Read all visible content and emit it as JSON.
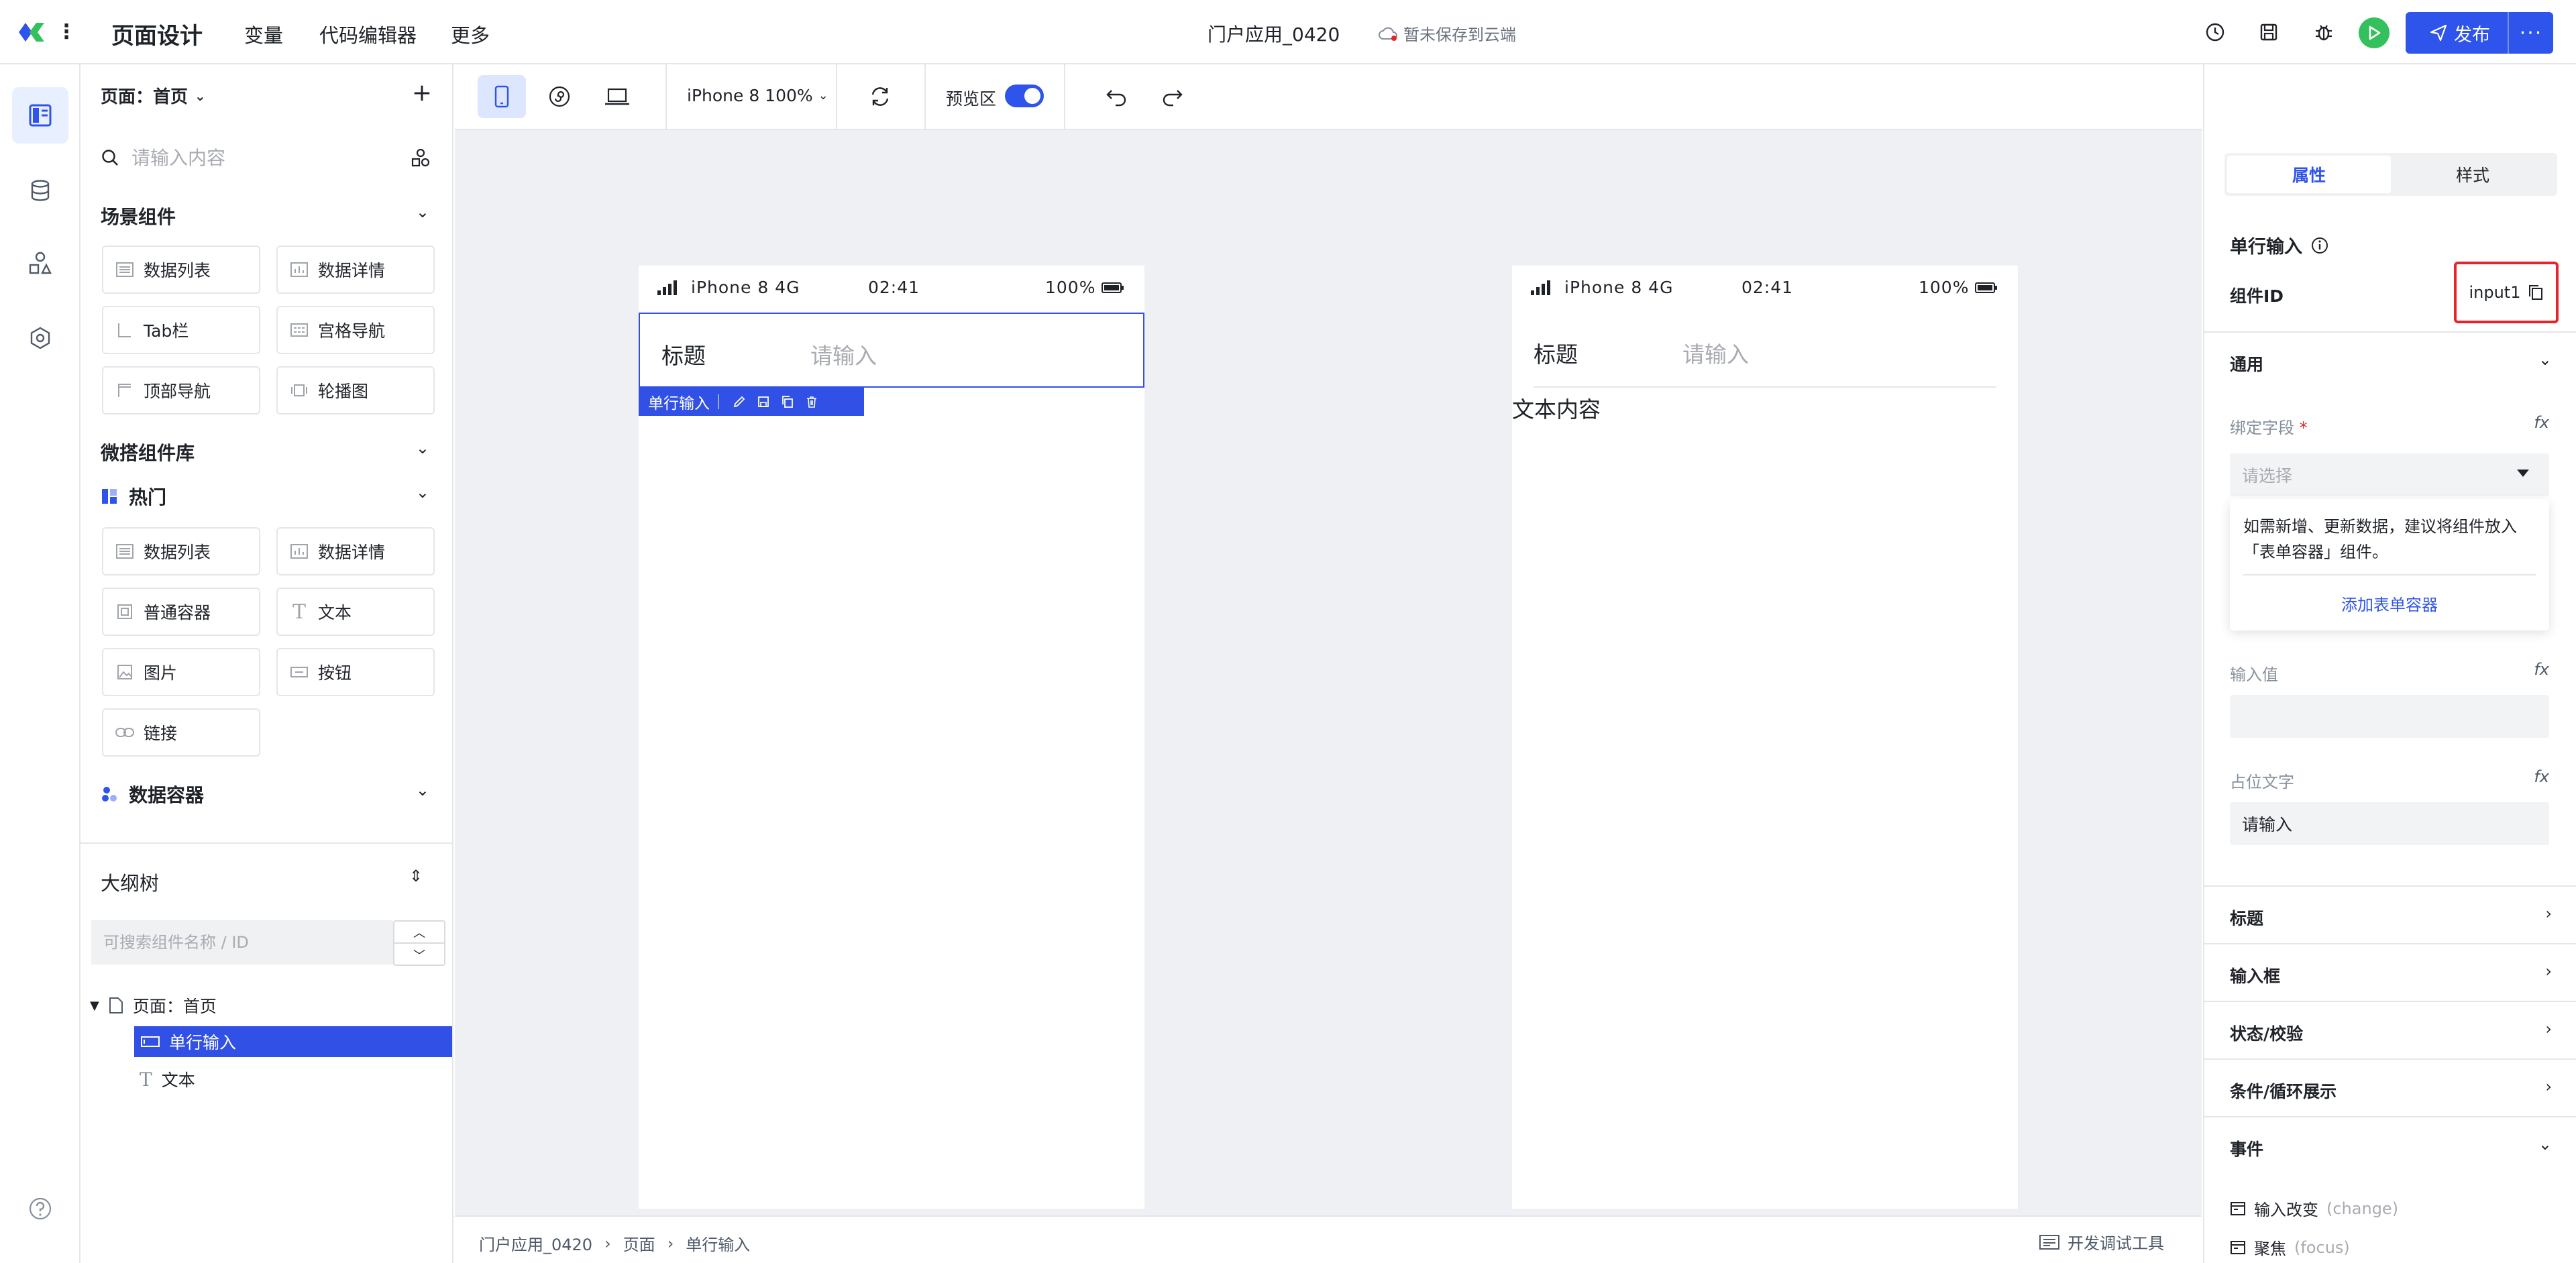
{
  "topbar": {
    "app_title": "页面设计",
    "nav": [
      "变量",
      "代码编辑器",
      "更多"
    ],
    "project_name": "门户应用_0420",
    "save_status": "暂未保存到云端",
    "publish_label": "发布",
    "more_label": "···"
  },
  "panel": {
    "page_selector": "页面：首页",
    "add_label": "+",
    "search_placeholder": "请输入内容",
    "groups": {
      "scene": {
        "title": "场景组件",
        "items": [
          "数据列表",
          "数据详情",
          "Tab栏",
          "宫格导航",
          "顶部导航",
          "轮播图"
        ]
      },
      "micro": {
        "title": "微搭组件库"
      },
      "hot": {
        "title": "热门",
        "items": [
          "数据列表",
          "数据详情",
          "普通容器",
          "文本",
          "图片",
          "按钮",
          "链接"
        ]
      },
      "data_container": {
        "title": "数据容器"
      }
    }
  },
  "outline": {
    "title": "大纲树",
    "search_placeholder": "可搜索组件名称 / ID",
    "tree": [
      {
        "label": "页面：首页"
      },
      {
        "label": "单行输入"
      },
      {
        "label": "文本"
      }
    ]
  },
  "canvas": {
    "device": "iPhone 8 100%",
    "preview_label": "预览区",
    "preview_on": true,
    "phone1": {
      "carrier": "iPhone 8  4G",
      "time": "02:41",
      "battery": "100%",
      "field_label": "标题",
      "field_placeholder": "请输入",
      "selection_label": "单行输入"
    },
    "phone2": {
      "carrier": "iPhone 8  4G",
      "time": "02:41",
      "battery": "100%",
      "field_label": "标题",
      "field_placeholder": "请输入",
      "text_content": "文本内容"
    },
    "breadcrumbs": [
      "门户应用_0420",
      "页面",
      "单行输入"
    ],
    "devtools_label": "开发调试工具"
  },
  "props": {
    "tabs": [
      "属性",
      "样式"
    ],
    "active_tab": "属性",
    "component_type": "单行输入",
    "component_id_label": "组件ID",
    "component_id": "input1",
    "section_general": "通用",
    "bind_field_label": "绑定字段",
    "bind_field_placeholder": "请选择",
    "hint_text": "如需新增、更新数据，建议将组件放入「表单容器」组件。",
    "hint_link": "添加表单容器",
    "input_value_label": "输入值",
    "input_value": "",
    "placeholder_label": "占位文字",
    "placeholder_value": "请输入",
    "fx_label": "fx",
    "sections": [
      "标题",
      "输入框",
      "状态/校验",
      "条件/循环展示"
    ],
    "events_title": "事件",
    "events": [
      {
        "name": "输入改变",
        "code": "(change)"
      },
      {
        "name": "聚焦",
        "code": "(focus)"
      }
    ]
  },
  "colors": {
    "primary": "#2f54eb",
    "selection": "#3150e5",
    "run": "#34c05c",
    "highlight_border": "#e8242b"
  }
}
